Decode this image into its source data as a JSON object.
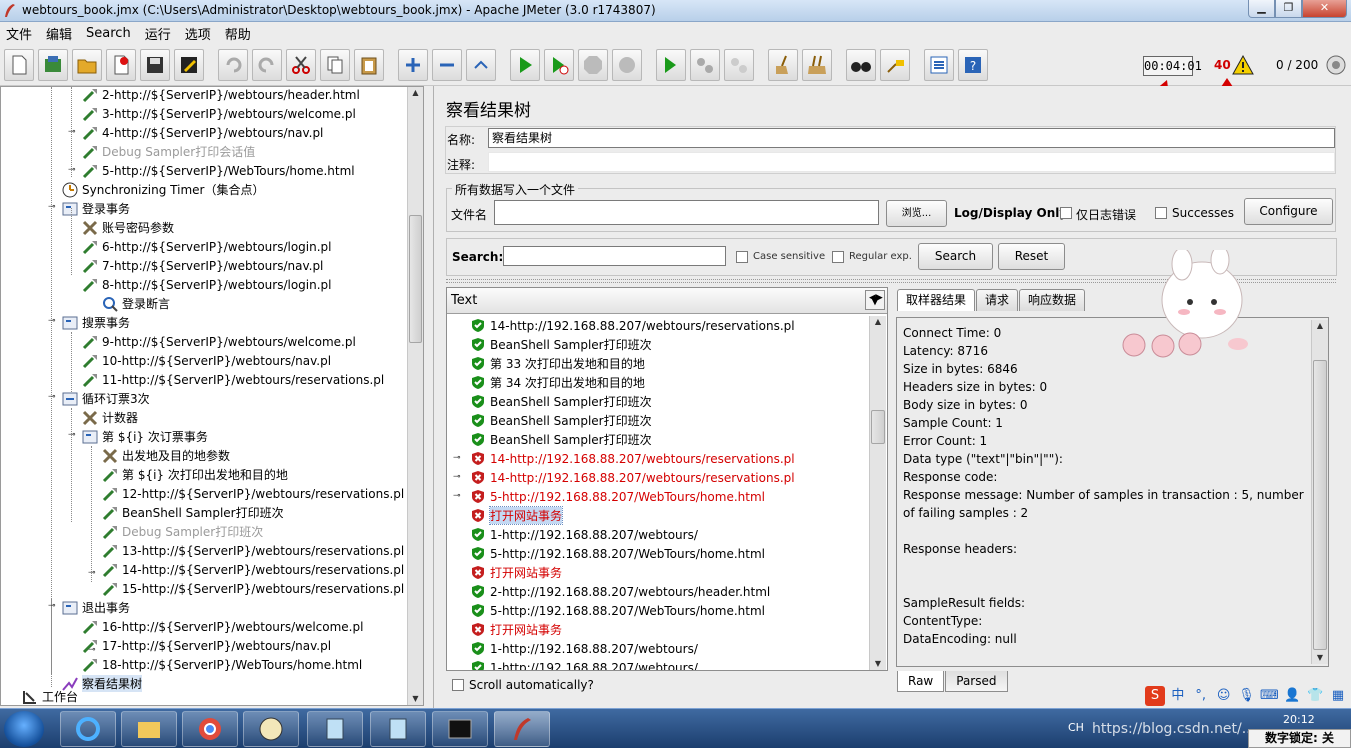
{
  "window": {
    "title": "webtours_book.jmx (C:\\Users\\Administrator\\Desktop\\webtours_book.jmx) - Apache JMeter (3.0 r1743807)",
    "min": "▁",
    "max": "❐",
    "close": "✕"
  },
  "menu": [
    "文件",
    "编辑",
    "Search",
    "运行",
    "选项",
    "帮助"
  ],
  "status": {
    "elapsed": "00:04:01",
    "error_count": "40",
    "threads": "0 / 200"
  },
  "tree": [
    {
      "label": "2-http://${ServerIP}/webtours/header.html",
      "icon": "sampler-icon",
      "disabled": false
    },
    {
      "label": "3-http://${ServerIP}/webtours/welcome.pl",
      "icon": "sampler-icon",
      "disabled": false
    },
    {
      "label": "4-http://${ServerIP}/webtours/nav.pl",
      "icon": "sampler-icon",
      "disabled": false
    },
    {
      "label": "Debug Sampler打印会话值",
      "icon": "sampler-icon",
      "disabled": true
    },
    {
      "label": "5-http://${ServerIP}/WebTours/home.html",
      "icon": "sampler-icon",
      "disabled": false
    },
    {
      "label": "Synchronizing Timer（集合点）",
      "icon": "timer-icon",
      "disabled": false
    },
    {
      "label": "登录事务",
      "icon": "transaction-icon",
      "disabled": false
    },
    {
      "label": "账号密码参数",
      "icon": "config-icon",
      "disabled": false
    },
    {
      "label": "6-http://${ServerIP}/webtours/login.pl",
      "icon": "sampler-icon",
      "disabled": false
    },
    {
      "label": "7-http://${ServerIP}/webtours/nav.pl",
      "icon": "sampler-icon",
      "disabled": false
    },
    {
      "label": "8-http://${ServerIP}/webtours/login.pl",
      "icon": "sampler-icon",
      "disabled": false
    },
    {
      "label": "登录断言",
      "icon": "assertion-icon",
      "disabled": false
    },
    {
      "label": "搜票事务",
      "icon": "transaction-icon",
      "disabled": false
    },
    {
      "label": "9-http://${ServerIP}/webtours/welcome.pl",
      "icon": "sampler-icon",
      "disabled": false
    },
    {
      "label": "10-http://${ServerIP}/webtours/nav.pl",
      "icon": "sampler-icon",
      "disabled": false
    },
    {
      "label": "11-http://${ServerIP}/webtours/reservations.pl",
      "icon": "sampler-icon",
      "disabled": false
    },
    {
      "label": "循环订票3次",
      "icon": "loop-icon",
      "disabled": false
    },
    {
      "label": "计数器",
      "icon": "config-icon",
      "disabled": false
    },
    {
      "label": "第 ${i} 次订票事务",
      "icon": "transaction-icon",
      "disabled": false
    },
    {
      "label": "出发地及目的地参数",
      "icon": "config-icon",
      "disabled": false
    },
    {
      "label": "第 ${i} 次打印出发地和目的地",
      "icon": "sampler-icon",
      "disabled": false
    },
    {
      "label": "12-http://${ServerIP}/webtours/reservations.pl",
      "icon": "sampler-icon",
      "disabled": false
    },
    {
      "label": "BeanShell Sampler打印班次",
      "icon": "sampler-icon",
      "disabled": false
    },
    {
      "label": "Debug Sampler打印班次",
      "icon": "sampler-icon",
      "disabled": true
    },
    {
      "label": "13-http://${ServerIP}/webtours/reservations.pl",
      "icon": "sampler-icon",
      "disabled": false
    },
    {
      "label": "14-http://${ServerIP}/webtours/reservations.pl",
      "icon": "sampler-icon",
      "disabled": false
    },
    {
      "label": "15-http://${ServerIP}/webtours/reservations.pl",
      "icon": "sampler-icon",
      "disabled": false
    },
    {
      "label": "退出事务",
      "icon": "transaction-icon",
      "disabled": false
    },
    {
      "label": "16-http://${ServerIP}/webtours/welcome.pl",
      "icon": "sampler-icon",
      "disabled": false
    },
    {
      "label": "17-http://${ServerIP}/webtours/nav.pl",
      "icon": "sampler-icon",
      "disabled": false
    },
    {
      "label": "18-http://${ServerIP}/WebTours/home.html",
      "icon": "sampler-icon",
      "disabled": false
    },
    {
      "label": "察看结果树",
      "icon": "listener-icon",
      "disabled": false
    },
    {
      "label": "工作台",
      "icon": "workbench-icon",
      "disabled": false
    }
  ],
  "panel": {
    "title": "察看结果树",
    "name_label": "名称:",
    "name_value": "察看结果树",
    "comment_label": "注释:",
    "comment_value": "",
    "file_group_title": "所有数据写入一个文件",
    "filename_label": "文件名",
    "filename_value": "",
    "browse_label": "浏览...",
    "log_display_label": "Log/Display Only:",
    "errors_only_label": "仅日志错误",
    "successes_label": "Successes",
    "configure_label": "Configure",
    "search_label": "Search:",
    "search_value": "",
    "case_sensitive_label": "Case sensitive",
    "regex_label": "Regular exp.",
    "search_button": "Search",
    "reset_button": "Reset",
    "renderer_label": "Text",
    "scroll_auto_label": "Scroll automatically?"
  },
  "results": [
    {
      "label": "14-http://192.168.88.207/webtours/reservations.pl",
      "status": "success"
    },
    {
      "label": "BeanShell Sampler打印班次",
      "status": "success"
    },
    {
      "label": "第 33 次打印出发地和目的地",
      "status": "success"
    },
    {
      "label": "第 34 次打印出发地和目的地",
      "status": "success"
    },
    {
      "label": "BeanShell Sampler打印班次",
      "status": "success"
    },
    {
      "label": "BeanShell Sampler打印班次",
      "status": "success"
    },
    {
      "label": "BeanShell Sampler打印班次",
      "status": "success"
    },
    {
      "label": "14-http://192.168.88.207/webtours/reservations.pl",
      "status": "fail"
    },
    {
      "label": "14-http://192.168.88.207/webtours/reservations.pl",
      "status": "fail"
    },
    {
      "label": "5-http://192.168.88.207/WebTours/home.html",
      "status": "fail"
    },
    {
      "label": "打开网站事务",
      "status": "fail",
      "selected": true
    },
    {
      "label": "1-http://192.168.88.207/webtours/",
      "status": "success"
    },
    {
      "label": "5-http://192.168.88.207/WebTours/home.html",
      "status": "success"
    },
    {
      "label": "打开网站事务",
      "status": "fail"
    },
    {
      "label": "2-http://192.168.88.207/webtours/header.html",
      "status": "success"
    },
    {
      "label": "5-http://192.168.88.207/WebTours/home.html",
      "status": "success"
    },
    {
      "label": "打开网站事务",
      "status": "fail"
    },
    {
      "label": "1-http://192.168.88.207/webtours/",
      "status": "success"
    },
    {
      "label": "1-http://192.168.88.207/webtours/",
      "status": "success"
    }
  ],
  "tabs": [
    "取样器结果",
    "请求",
    "响应数据"
  ],
  "detail": {
    "lines": [
      "Connect Time: 0",
      "Latency: 8716",
      "Size in bytes: 6846",
      "Headers size in bytes: 0",
      "Body size in bytes: 0",
      "Sample Count: 1",
      "Error Count: 1",
      "Data type (\"text\"|\"bin\"|\"\"):",
      "Response code:",
      "Response message: Number of samples in transaction : 5, number of failing samples : 2",
      "",
      "Response headers:",
      "",
      "",
      "SampleResult fields:",
      "ContentType:",
      "DataEncoding: null"
    ]
  },
  "bottom_tabs": [
    "Raw",
    "Parsed"
  ],
  "taskbar": {
    "lang": "CH",
    "clock": "20:12",
    "numlock": "数字锁定: 关",
    "watermark": "https://blog.csdn.net/..."
  },
  "colors": {
    "accent": "#1f4e8c",
    "error": "#d40000",
    "success": "#1a8f1a"
  }
}
